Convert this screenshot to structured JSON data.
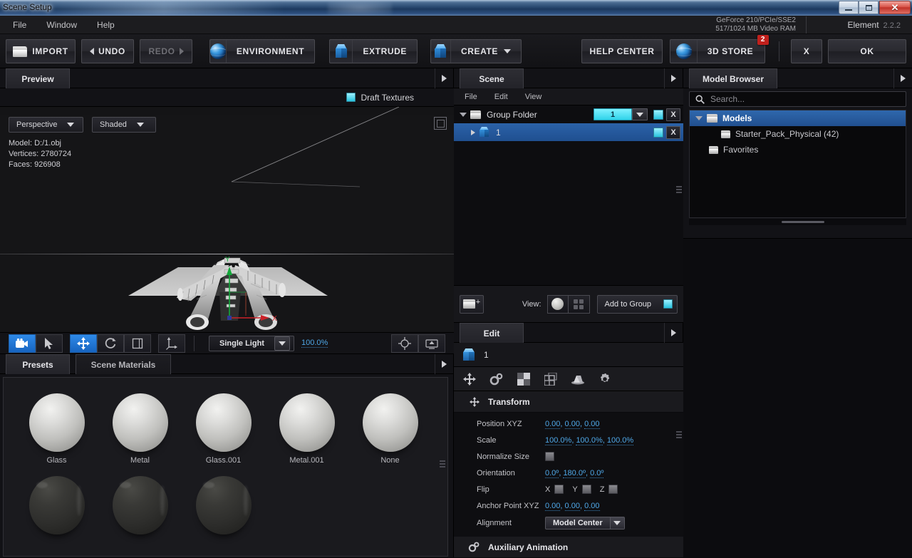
{
  "window": {
    "title": "Scene Setup",
    "minimize": "minimize-icon",
    "maximize": "restore-icon",
    "close": "✕"
  },
  "menubar": {
    "items": [
      "File",
      "Window",
      "Help"
    ],
    "gpu_line1": "GeForce 210/PCIe/SSE2",
    "gpu_line2": "517/1024 MB Video RAM",
    "product": "Element",
    "version": "2.2.2"
  },
  "toolbar": {
    "import": "IMPORT",
    "undo": "UNDO",
    "redo": "REDO",
    "environment": "ENVIRONMENT",
    "extrude": "EXTRUDE",
    "create": "CREATE",
    "help_center": "HELP CENTER",
    "store": "3D STORE",
    "store_badge": "2",
    "cancel": "X",
    "ok": "OK"
  },
  "preview": {
    "tab": "Preview",
    "draft_textures_label": "Draft Textures",
    "draft_textures_checked": true,
    "camera_mode": "Perspective",
    "shading_mode": "Shaded",
    "info": {
      "model_label": "Model:",
      "model_value": "D:/1.obj",
      "vertices_label": "Vertices:",
      "vertices_value": "2780724",
      "faces_label": "Faces:",
      "faces_value": "926908"
    },
    "axis_x": "X",
    "axis_y": "Y",
    "toolbar": {
      "tools": [
        {
          "name": "camera-tool",
          "active": true
        },
        {
          "name": "select-tool",
          "active": false
        },
        {
          "name": "move-tool",
          "active": true
        },
        {
          "name": "rotate-tool",
          "active": false
        },
        {
          "name": "scale-tool",
          "active": false
        },
        {
          "name": "axis-tool",
          "active": false
        }
      ],
      "light_mode": "Single Light",
      "light_intensity": "100.0%",
      "focus_icon": "crosshair-icon",
      "fit_icon": "fit-to-view-icon"
    }
  },
  "materials": {
    "tabs": [
      {
        "label": "Presets",
        "active": true
      },
      {
        "label": "Scene Materials",
        "active": false
      }
    ],
    "items": [
      {
        "label": "Glass",
        "style": "light"
      },
      {
        "label": "Metal",
        "style": "light"
      },
      {
        "label": "Glass.001",
        "style": "light"
      },
      {
        "label": "Metal.001",
        "style": "light"
      },
      {
        "label": "None",
        "style": "light"
      },
      {
        "label": "",
        "style": "dark"
      },
      {
        "label": "",
        "style": "dark"
      },
      {
        "label": "",
        "style": "dark"
      }
    ]
  },
  "scene": {
    "tab": "Scene",
    "menu": [
      "File",
      "Edit",
      "View"
    ],
    "rows": [
      {
        "name": "Group Folder",
        "icon": "folder-icon",
        "count": "1",
        "selected": false,
        "has_count": true,
        "indent": 0,
        "close": "X"
      },
      {
        "name": "1",
        "icon": "cube-icon",
        "count": "",
        "selected": true,
        "has_count": false,
        "indent": 1,
        "close": "X"
      }
    ],
    "bottom": {
      "new_group_icon": "new-folder-icon",
      "view_label": "View:",
      "view_sphere_icon": "sphere-preview-icon",
      "view_grid_icon": "grid-preview-icon",
      "add_to_group": "Add to Group",
      "add_to_group_checked": true
    }
  },
  "edit": {
    "tab": "Edit",
    "object_name": "1",
    "icons": [
      "transform-icon",
      "animation-icon",
      "material-icon",
      "group-icon",
      "ambient-occlusion-icon",
      "settings-icon"
    ],
    "sections": [
      {
        "title": "Transform",
        "icon": "move-icon"
      },
      {
        "title": "Auxiliary Animation",
        "icon": "gears-icon"
      }
    ],
    "properties": [
      {
        "label": "Position XYZ",
        "type": "triple",
        "values": [
          "0.00",
          "0.00",
          "0.00"
        ]
      },
      {
        "label": "Scale",
        "type": "triple",
        "values": [
          "100.0%",
          "100.0%",
          "100.0%"
        ]
      },
      {
        "label": "Normalize Size",
        "type": "checkbox",
        "checked": false
      },
      {
        "label": "Orientation",
        "type": "triple",
        "values": [
          "0.0º",
          "180.0º",
          "0.0º"
        ]
      },
      {
        "label": "Flip",
        "type": "flip",
        "axes": [
          "X",
          "Y",
          "Z"
        ]
      },
      {
        "label": "Anchor Point XYZ",
        "type": "triple",
        "values": [
          "0.00",
          "0.00",
          "0.00"
        ]
      },
      {
        "label": "Alignment",
        "type": "dropdown",
        "value": "Model Center"
      }
    ]
  },
  "browser": {
    "tab": "Model Browser",
    "search_placeholder": "Search...",
    "search_value": "",
    "search_icon": "search-icon",
    "tree": [
      {
        "label": "Models",
        "icon": "folder-icon",
        "indent": 0,
        "selected": true,
        "expanded": true
      },
      {
        "label": "Starter_Pack_Physical (42)",
        "icon": "folder-icon",
        "indent": 2,
        "selected": false,
        "expanded": false
      },
      {
        "label": "Favorites",
        "icon": "folder-icon",
        "indent": 1,
        "selected": false,
        "expanded": false
      }
    ]
  },
  "colors": {
    "accent_blue": "#2f68ad",
    "cyan": "#27c2dd",
    "value_blue": "#4fa8e8",
    "badge_red": "#c0201c",
    "panel_bg": "#121216"
  }
}
